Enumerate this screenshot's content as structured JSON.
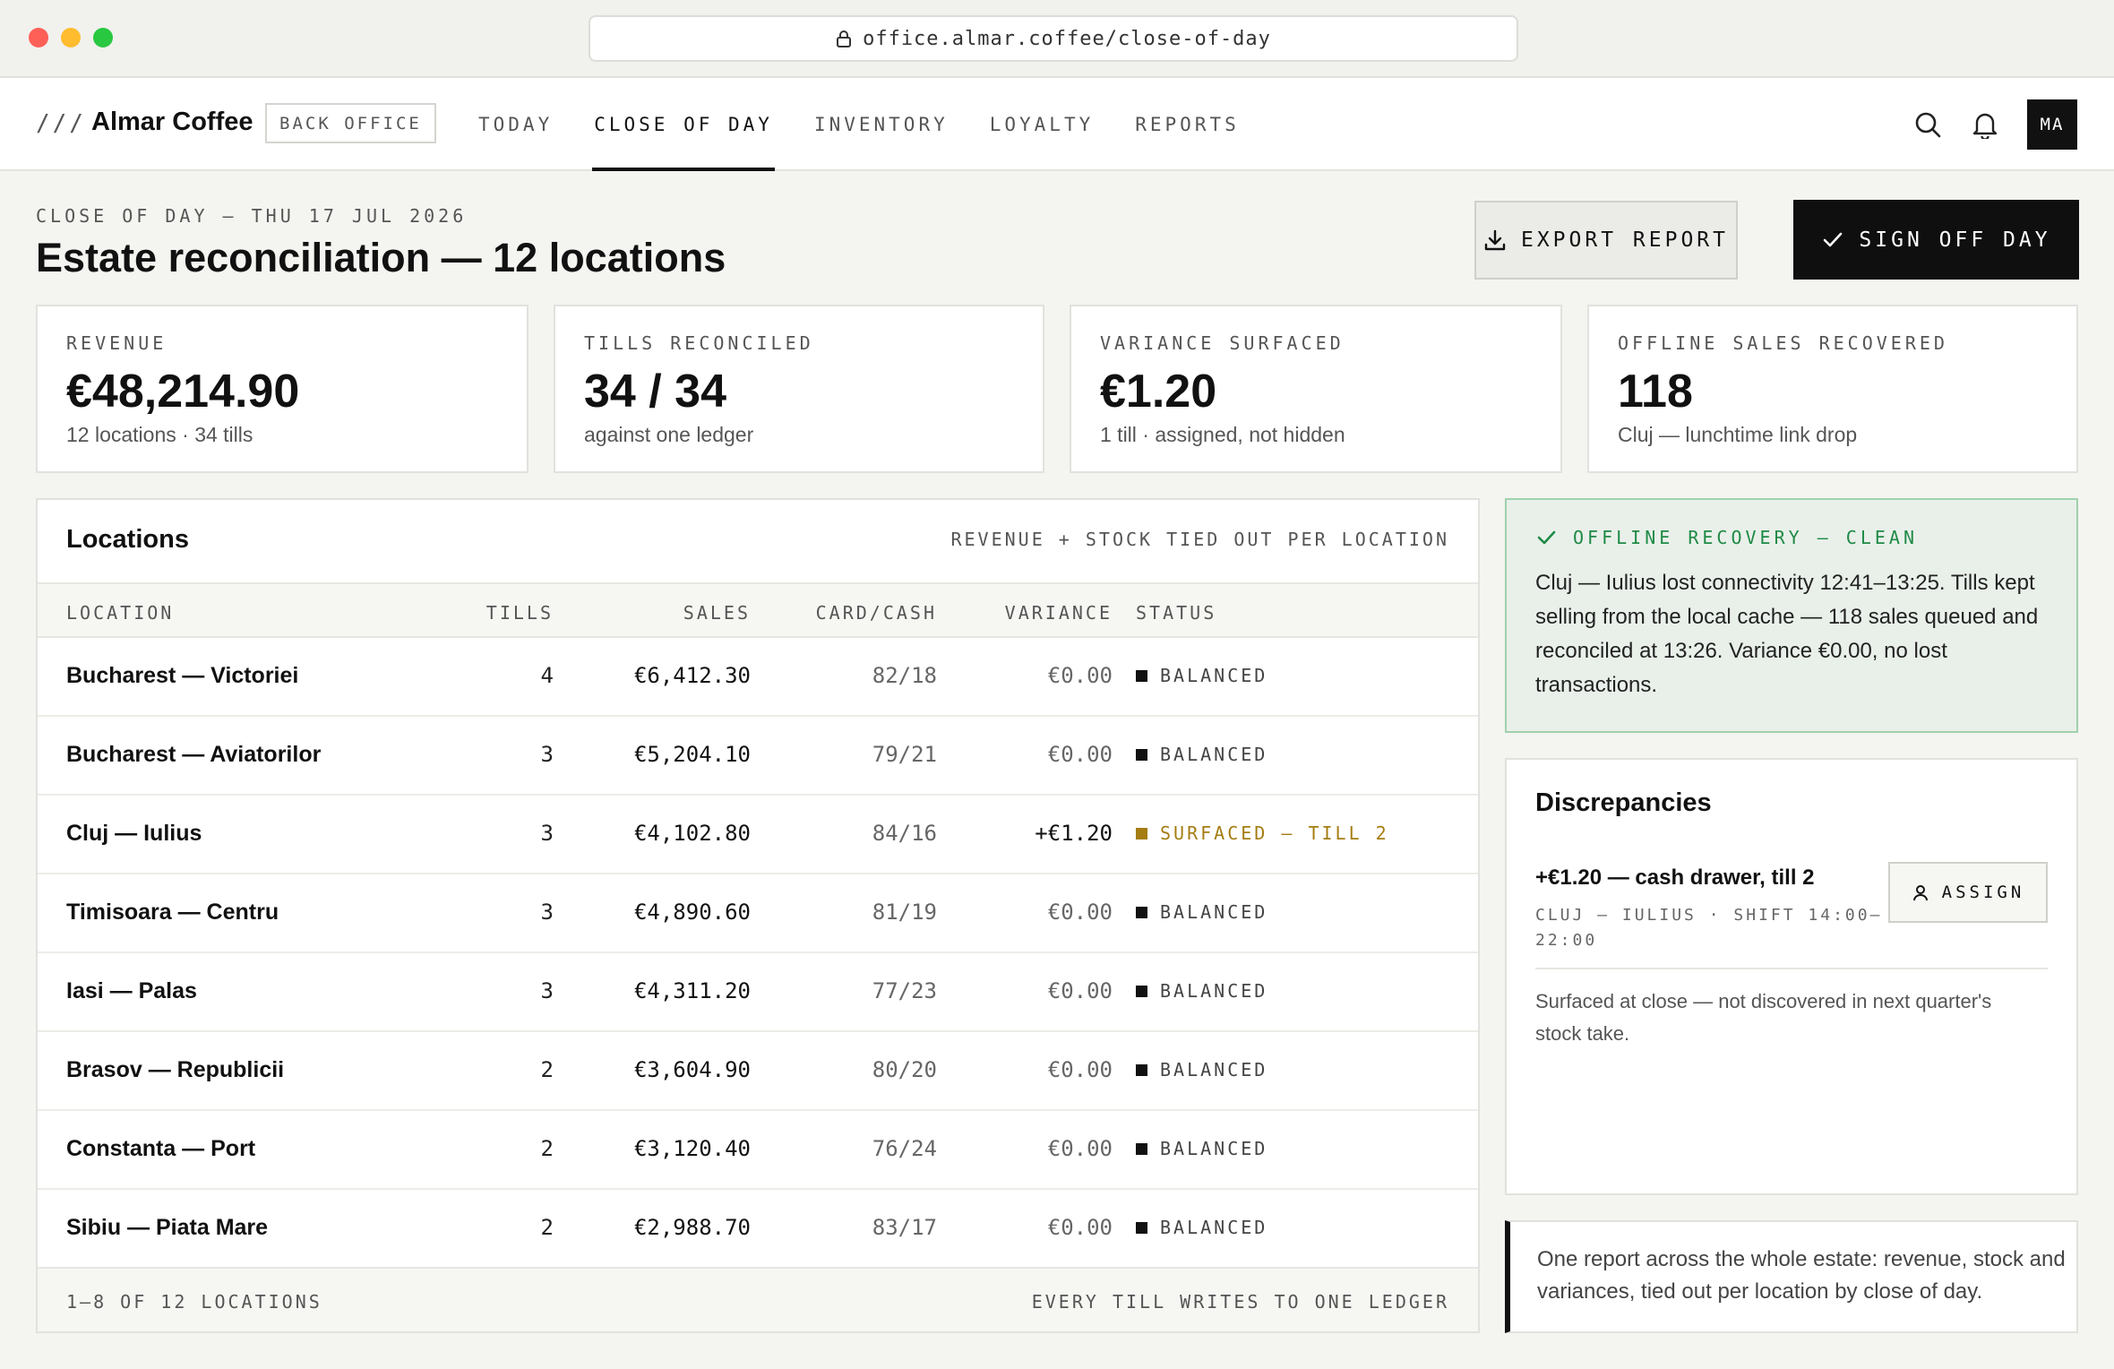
{
  "browser": {
    "url": "office.almar.coffee/close-of-day"
  },
  "header": {
    "brand_mark": "///",
    "brand_name": "Almar Coffee",
    "badge": "BACK OFFICE",
    "nav": [
      "TODAY",
      "CLOSE OF DAY",
      "INVENTORY",
      "LOYALTY",
      "REPORTS"
    ],
    "active_nav": "CLOSE OF DAY",
    "avatar_initials": "MA",
    "icons": [
      "search-icon",
      "bell-icon"
    ]
  },
  "page": {
    "eyebrow": "CLOSE OF DAY — THU 17 JUL 2026",
    "title": "Estate reconciliation — 12 locations",
    "export_label": "EXPORT REPORT",
    "signoff_label": "SIGN OFF DAY"
  },
  "kpis": [
    {
      "label": "REVENUE",
      "value": "€48,214.90",
      "sub": "12 locations · 34 tills"
    },
    {
      "label": "TILLS RECONCILED",
      "value": "34 / 34",
      "sub": "against one ledger"
    },
    {
      "label": "VARIANCE SURFACED",
      "value": "€1.20",
      "sub": "1 till · assigned, not hidden"
    },
    {
      "label": "OFFLINE SALES RECOVERED",
      "value": "118",
      "sub": "Cluj — lunchtime link drop"
    }
  ],
  "locations": {
    "title": "Locations",
    "note": "REVENUE + STOCK TIED OUT PER LOCATION",
    "columns": {
      "location": "LOCATION",
      "tills": "TILLS",
      "sales": "SALES",
      "card_cash": "CARD/CASH",
      "variance": "VARIANCE",
      "status": "STATUS"
    },
    "rows": [
      {
        "name": "Bucharest — Victoriei",
        "tills": "4",
        "sales": "€6,412.30",
        "card_cash": "82/18",
        "variance": "€0.00",
        "status": "BALANCED"
      },
      {
        "name": "Bucharest — Aviatorilor",
        "tills": "3",
        "sales": "€5,204.10",
        "card_cash": "79/21",
        "variance": "€0.00",
        "status": "BALANCED"
      },
      {
        "name": "Cluj — Iulius",
        "tills": "3",
        "sales": "€4,102.80",
        "card_cash": "84/16",
        "variance": "+€1.20",
        "status": "SURFACED — TILL 2"
      },
      {
        "name": "Timisoara — Centru",
        "tills": "3",
        "sales": "€4,890.60",
        "card_cash": "81/19",
        "variance": "€0.00",
        "status": "BALANCED"
      },
      {
        "name": "Iasi — Palas",
        "tills": "3",
        "sales": "€4,311.20",
        "card_cash": "77/23",
        "variance": "€0.00",
        "status": "BALANCED"
      },
      {
        "name": "Brasov — Republicii",
        "tills": "2",
        "sales": "€3,604.90",
        "card_cash": "80/20",
        "variance": "€0.00",
        "status": "BALANCED"
      },
      {
        "name": "Constanta — Port",
        "tills": "2",
        "sales": "€3,120.40",
        "card_cash": "76/24",
        "variance": "€0.00",
        "status": "BALANCED"
      },
      {
        "name": "Sibiu — Piata Mare",
        "tills": "2",
        "sales": "€2,988.70",
        "card_cash": "83/17",
        "variance": "€0.00",
        "status": "BALANCED"
      }
    ],
    "footer_left": "1–8 OF 12 LOCATIONS",
    "footer_right": "EVERY TILL WRITES TO ONE LEDGER",
    "status_colors": {
      "balanced": "#111111",
      "surfaced": "#a57d12"
    }
  },
  "offline": {
    "heading": "OFFLINE RECOVERY — CLEAN",
    "body": "Cluj — Iulius lost connectivity 12:41–13:25. Tills kept selling from the local cache — 118 sales queued and reconciled at 13:26. Variance €0.00, no lost transactions.",
    "accent": "#1f8a46"
  },
  "discrepancies": {
    "title": "Discrepancies",
    "item_title": "+€1.20 — cash drawer, till 2",
    "item_meta": "CLUJ — IULIUS · SHIFT 14:00–22:00",
    "assign_label": "ASSIGN",
    "note": "Surfaced at close — not discovered in next quarter's stock take."
  },
  "quote": {
    "text": "One report across the whole estate: revenue, stock and variances, tied out per location by close of day."
  }
}
